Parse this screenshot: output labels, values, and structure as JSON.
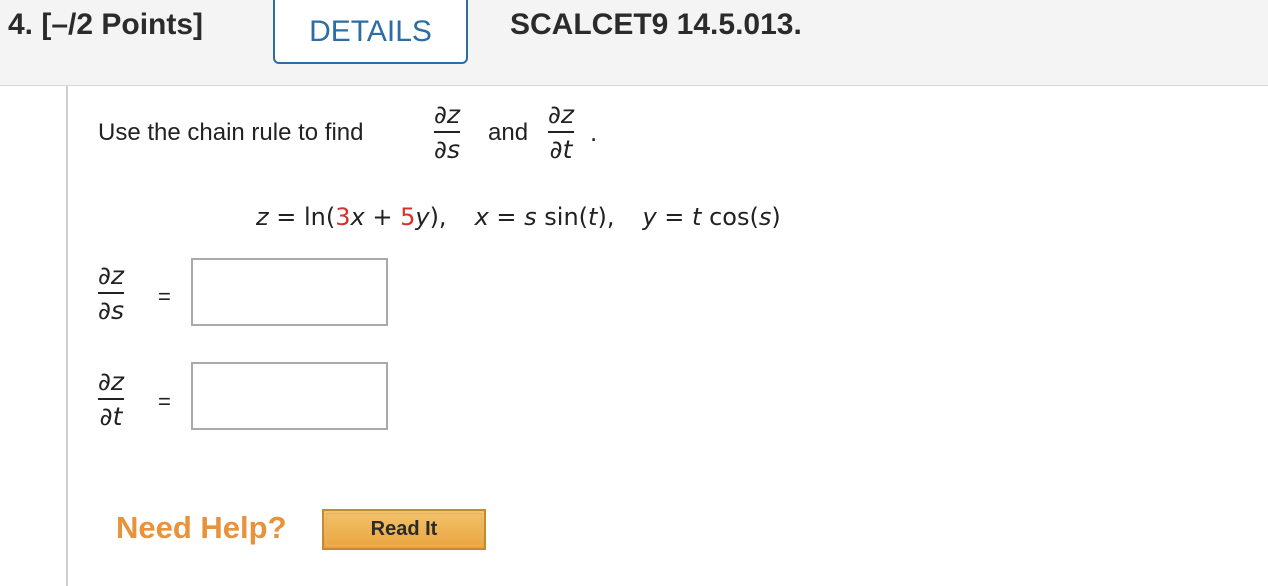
{
  "header": {
    "question_points": "4. [–/2 Points]",
    "details_label": "DETAILS",
    "question_id": "SCALCET9 14.5.013."
  },
  "problem": {
    "prompt_text": "Use the chain rule to find",
    "frac1_num": "∂z",
    "frac1_den": "∂s",
    "and_text": "and",
    "frac2_num": "∂z",
    "frac2_den": "∂t",
    "period": ".",
    "equation": {
      "z_eq": "z",
      "ln_open": " = ln(",
      "coef_x": "3",
      "x": "x",
      "plus": " + ",
      "coef_y": "5",
      "y": "y",
      "close": "),",
      "x_def_var": "x",
      "x_def_eq": " = ",
      "x_def_s": "s",
      "x_def_sin": " sin(",
      "x_def_t": "t",
      "x_def_close": "),",
      "y_def_var": "y",
      "y_def_eq": " = ",
      "y_def_t": "t",
      "y_def_cos": " cos(",
      "y_def_s": "s",
      "y_def_close": ")"
    }
  },
  "answers": [
    {
      "num": "∂z",
      "den": "∂s",
      "equals": "=",
      "value": ""
    },
    {
      "num": "∂z",
      "den": "∂t",
      "equals": "=",
      "value": ""
    }
  ],
  "help": {
    "need_help_label": "Need Help?",
    "read_it_label": "Read It"
  },
  "colors": {
    "details_blue": "#2e6da4",
    "coefficient_red": "#d6322a",
    "help_orange": "#e8923a",
    "button_gold": "#e9a43f"
  }
}
